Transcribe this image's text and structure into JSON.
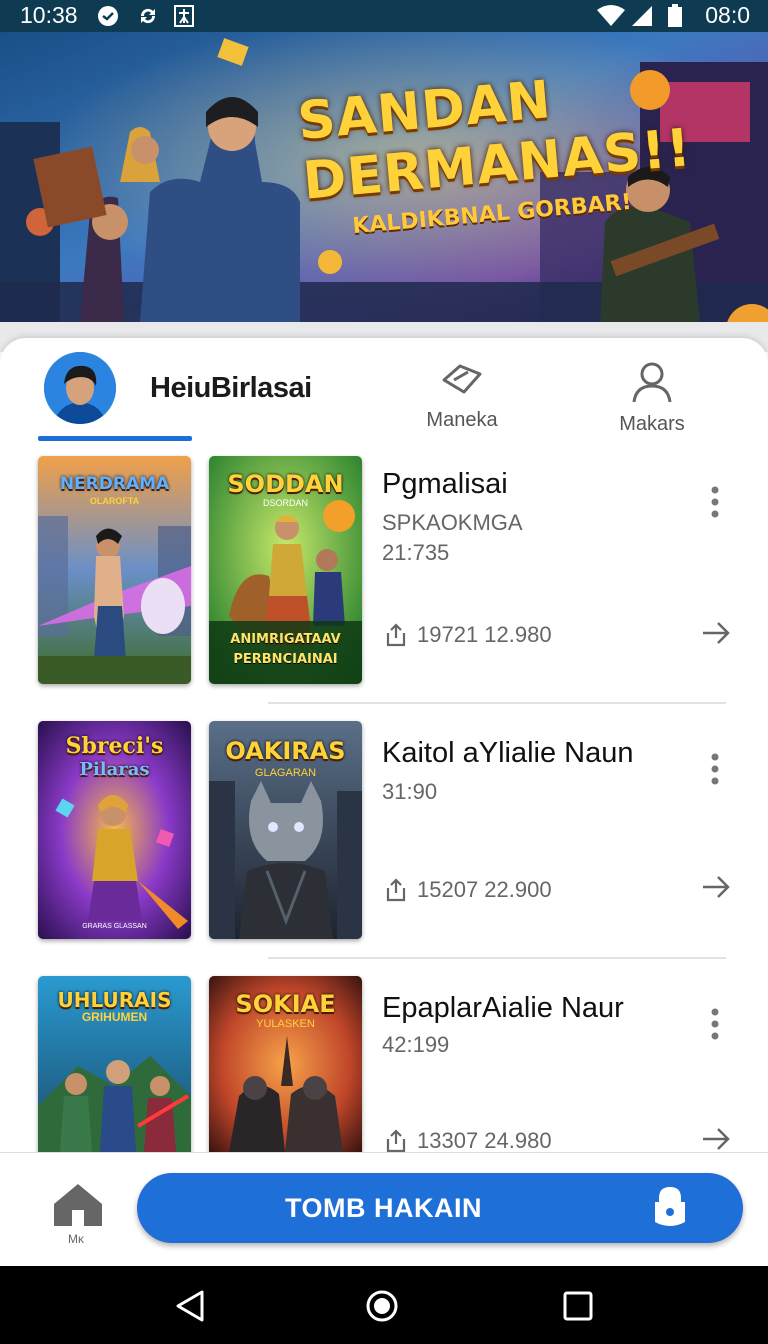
{
  "status_bar": {
    "time": "10:38",
    "battery": "08:0"
  },
  "banner": {
    "title_line1": "SANDAN",
    "title_line2": "DERMANAS!!",
    "subtitle": "KALDIKBNAL GORBAR!"
  },
  "profile": {
    "name": "HeiuBirlasai"
  },
  "tabs": [
    {
      "label": "Maneka",
      "icon": "tag-icon"
    },
    {
      "label": "Makars",
      "icon": "person-icon"
    }
  ],
  "items": [
    {
      "title": "Pgmalisai",
      "subtitle": "SPKAOKMGA",
      "meta": "21:735",
      "count": "19721 12.980",
      "poster_a": {
        "title": "NERDRAMA",
        "caption": "OLAROFTA"
      },
      "poster_b": {
        "title": "SODDAN",
        "caption": "DSORDAN",
        "footer_line1": "ANIMRIGATAAV",
        "footer_line2": "PERBNCIAINAI"
      }
    },
    {
      "title": "Kaitol aYlialie Naun",
      "meta": "31:90",
      "count": "15207 22.900",
      "poster_a": {
        "title": "Sbreci's",
        "title2": "Pilaras",
        "caption": "GRARAS GLASSAN"
      },
      "poster_b": {
        "title": "OAKIRAS",
        "caption": "GLAGARAN"
      }
    },
    {
      "title": "EpaplarAialie Naur",
      "meta": "42:199",
      "count": "13307 24.980",
      "poster_a": {
        "title": "UHLURAIS",
        "caption": "GRIHUMEN"
      },
      "poster_b": {
        "title": "SOKIAE",
        "caption": "YULASKEN"
      }
    }
  ],
  "bottom_bar": {
    "home_label": "Mĸ",
    "cta_label": "TOMB HAKAIN"
  },
  "colors": {
    "accent": "#1f6fd8",
    "status_bar": "#0f3b52"
  }
}
